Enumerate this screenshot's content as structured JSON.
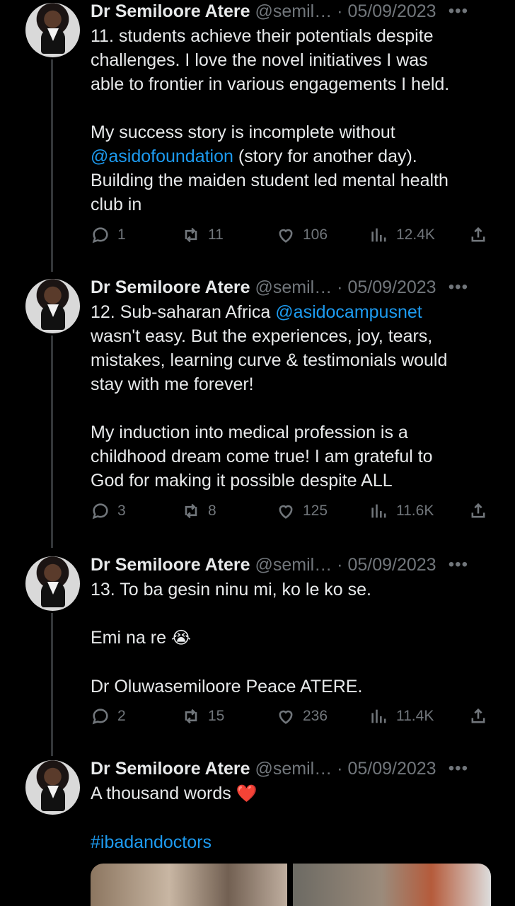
{
  "tweets": [
    {
      "name": "Dr Semiloore Atere",
      "handle": "@semil…",
      "date": "05/09/2023",
      "more": "•••",
      "lines": [
        "11. students achieve their potentials despite",
        "challenges. I love the novel initiatives I was",
        "able to frontier in various engagements I held.",
        "",
        "My success story is incomplete without",
        {
          "link": "@asidofoundation",
          "rest": " (story for another day)."
        },
        "Building the maiden student led mental health",
        "club in"
      ],
      "replies": "1",
      "reposts": "11",
      "likes": "106",
      "views": "12.4K"
    },
    {
      "name": "Dr Semiloore Atere",
      "handle": "@semil…",
      "date": "05/09/2023",
      "more": "•••",
      "lines": [
        {
          "before": "12. Sub-saharan Africa ",
          "link": "@asidocampusnet"
        },
        "wasn't easy. But the experiences, joy, tears,",
        "mistakes, learning curve & testimonials would",
        "stay with me forever!",
        "",
        "My induction into medical profession is a",
        "childhood dream come true! I am grateful to",
        "God for making it possible despite ALL"
      ],
      "replies": "3",
      "reposts": "8",
      "likes": "125",
      "views": "11.6K"
    },
    {
      "name": "Dr Semiloore Atere",
      "handle": "@semil…",
      "date": "05/09/2023",
      "more": "•••",
      "lines": [
        "13. To ba gesin ninu mi, ko le ko se.",
        "",
        "Emi na re",
        "",
        "Dr Oluwasemiloore Peace ATERE."
      ],
      "emoji": "😭",
      "replies": "2",
      "reposts": "15",
      "likes": "236",
      "views": "11.4K"
    },
    {
      "name": "Dr Semiloore Atere",
      "handle": "@semil…",
      "date": "05/09/2023",
      "more": "•••",
      "lines": [
        "A thousand words",
        "",
        {
          "link": "#ibadandoctors"
        }
      ],
      "emoji": "❤️"
    }
  ]
}
